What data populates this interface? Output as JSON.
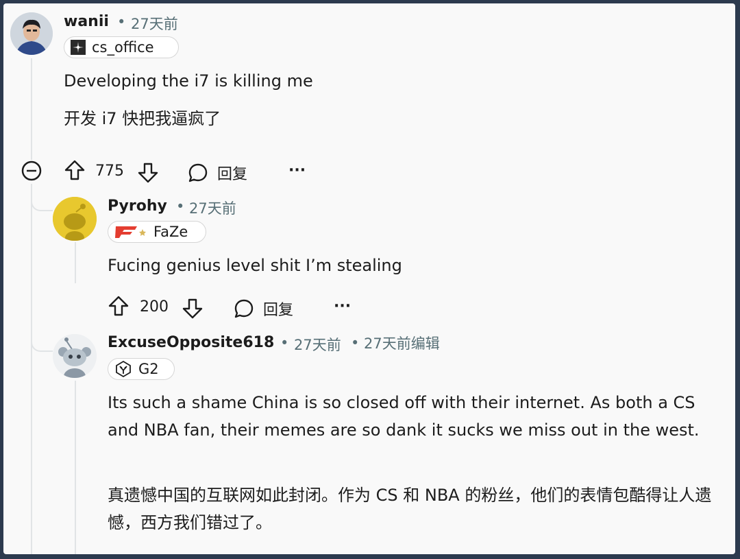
{
  "comments": [
    {
      "username": "wanii",
      "time": "27天前",
      "flair": "cs_office",
      "body_en": "Developing the i7 is killing me",
      "body_cn": "开发 i7 快把我逼疯了",
      "votes": "775",
      "reply_label": "回复",
      "more_label": "···"
    },
    {
      "username": "Pyrohy",
      "time": "27天前",
      "flair": "FaZe",
      "body_en": "Fucing genius level shit I’m stealing",
      "votes": "200",
      "reply_label": "回复",
      "more_label": "···"
    },
    {
      "username": "ExcuseOpposite618",
      "time": "27天前",
      "edited": "27天前编辑",
      "flair": "G2",
      "body_en": "Its such a shame China is so closed off with their internet. As both a CS and NBA fan, their memes are so dank it sucks we miss out in the west.",
      "body_cn": "真遗憾中国的互联网如此封闭。作为 CS 和 NBA 的粉丝，他们的表情包酷得让人遗憾，西方我们错过了。"
    }
  ],
  "colors": {
    "text": "#1c1c1c",
    "meta": "#576f76",
    "thread_line": "#e1e4e6",
    "faze_red": "#e43d30",
    "pyrohy_avatar": "#e8c82e"
  }
}
